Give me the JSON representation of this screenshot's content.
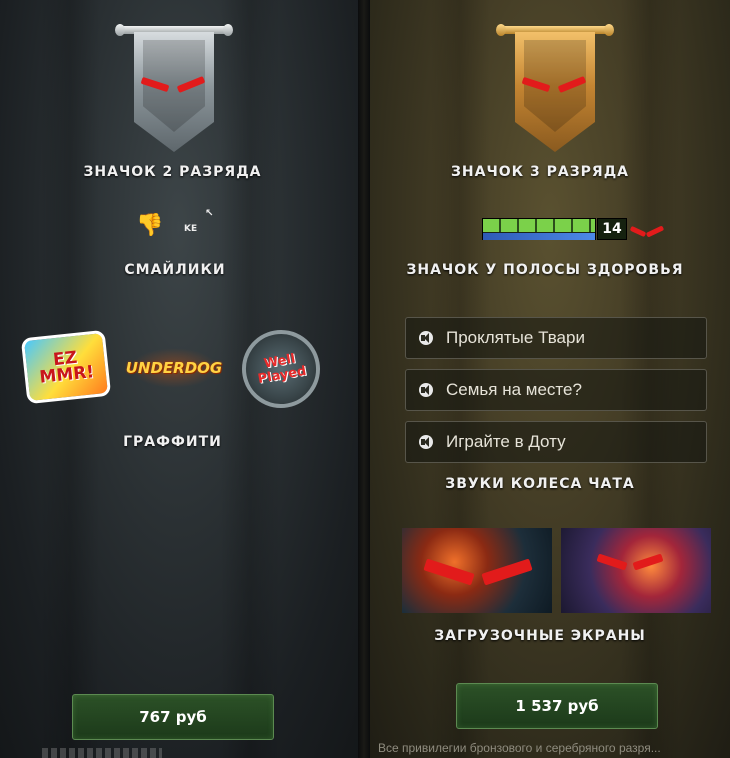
{
  "left_panel": {
    "badge_caption": "ЗНАЧОК 2 РАЗРЯДА",
    "emoticons_caption": "СМАЙЛИКИ",
    "emoticon_text": "KE",
    "graffiti_caption": "ГРАФФИТИ",
    "graffiti": [
      {
        "name": "ez-mmr",
        "text": "EZ MMR!"
      },
      {
        "name": "underdog",
        "text": "UNDERDOG"
      },
      {
        "name": "well-played",
        "text": "Well Played"
      }
    ],
    "price_label": "767 руб"
  },
  "right_panel": {
    "badge_caption": "ЗНАЧОК 3 РАЗРЯДА",
    "healthbar_level": "14",
    "healthbar_caption": "ЗНАЧОК У ПОЛОСЫ ЗДОРОВЬЯ",
    "sounds": [
      {
        "label": "Проклятые Твари"
      },
      {
        "label": "Семья на месте?"
      },
      {
        "label": "Играйте в Доту"
      }
    ],
    "sounds_caption": "ЗВУКИ КОЛЕСА ЧАТА",
    "loading_caption": "ЗАГРУЗОЧНЫЕ ЭКРАНЫ",
    "price_label": "1 537 руб",
    "footnote": "Все привилегии бронзового и серебряного разря..."
  },
  "colors": {
    "accent_red": "#e21b1b",
    "button_green": "#2c5127"
  }
}
